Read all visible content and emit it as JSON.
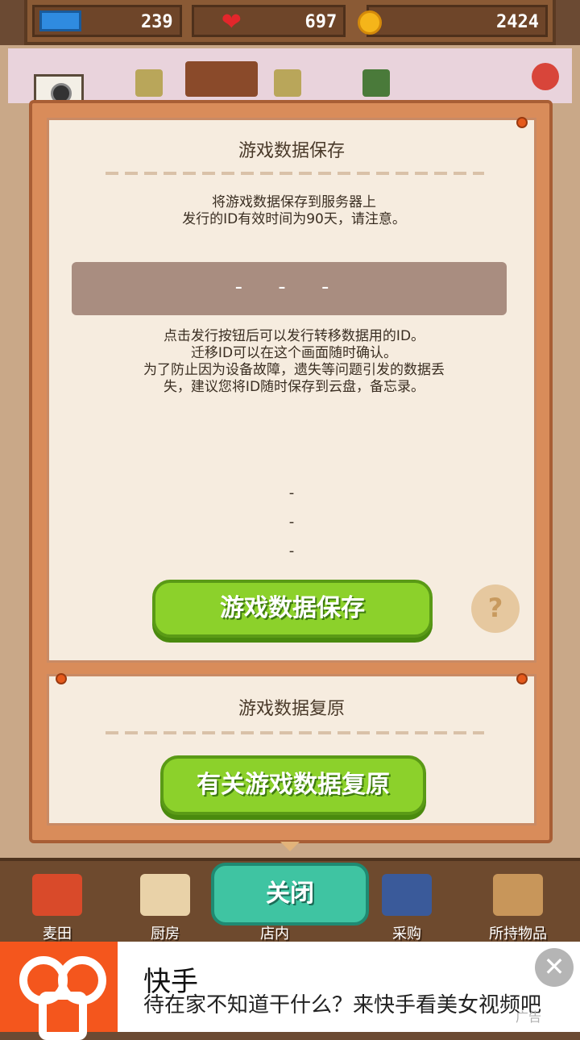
{
  "topbar": {
    "tickets": "239",
    "hearts": "697",
    "coins": "2424"
  },
  "camera": {
    "label": "照相"
  },
  "save_panel": {
    "title": "游戏数据保存",
    "description": "将游戏数据保存到服务器上\n发行的ID有效时间为90天，请注意。",
    "id_value": "- - -",
    "notice": "点击发行按钮后可以发行转移数据用的ID。\n迁移ID可以在这个画面随时确认。\n为了防止因为设备故障，遗失等问题引发的数据丢\n失，建议您将ID随时保存到云盘，备忘录。",
    "dashes": [
      "-",
      "-",
      "-"
    ],
    "save_button": "游戏数据保存",
    "help_button": "?"
  },
  "restore_panel": {
    "title": "游戏数据复原",
    "restore_button": "有关游戏数据复原"
  },
  "bottom_nav": {
    "items": [
      {
        "label": "麦田"
      },
      {
        "label": "厨房"
      },
      {
        "label": "店内"
      },
      {
        "label": "采购"
      },
      {
        "label": "所持物品"
      }
    ],
    "close_button": "关闭"
  },
  "ad": {
    "title": "快手",
    "text": "待在家不知道干什么？来快手看美女视频吧",
    "tag": "广告",
    "close": "✕"
  },
  "colors": {
    "primary_green": "#8cd12b",
    "close_teal": "#3fc4a2",
    "ad_orange": "#f4561d"
  }
}
